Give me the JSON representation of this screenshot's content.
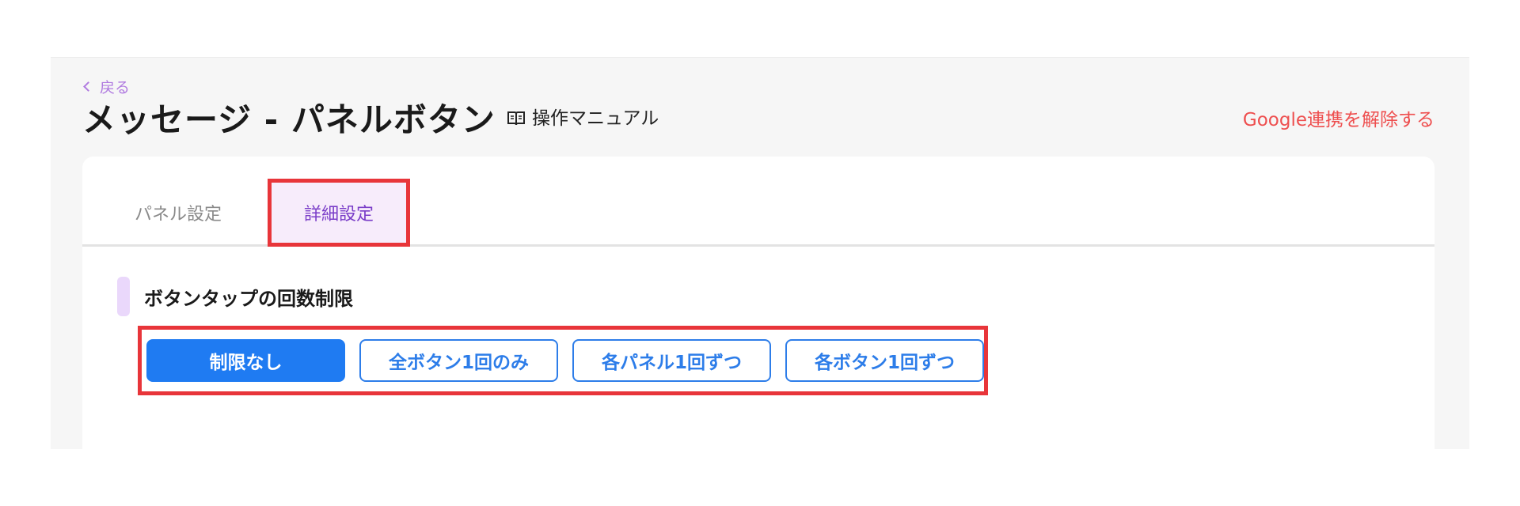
{
  "header": {
    "back_label": "戻る",
    "title": "メッセージ - パネルボタン",
    "manual_label": "操作マニュアル",
    "unlink_google_label": "Google連携を解除する"
  },
  "tabs": [
    {
      "label": "パネル設定",
      "selected": false
    },
    {
      "label": "詳細設定",
      "selected": true
    }
  ],
  "section": {
    "title": "ボタンタップの回数制限"
  },
  "limit_options": [
    {
      "label": "制限なし",
      "selected": true
    },
    {
      "label": "全ボタン1回のみ",
      "selected": false
    },
    {
      "label": "各パネル1回ずつ",
      "selected": false
    },
    {
      "label": "各ボタン1回ずつ",
      "selected": false
    }
  ],
  "colors": {
    "accent_purple": "#7a3dc8",
    "danger_red": "#ee4f4f",
    "primary_blue": "#1f7bf2",
    "highlight_box": "#e8353a"
  },
  "icons": {
    "back": "chevron-left-icon",
    "manual": "book-icon"
  }
}
